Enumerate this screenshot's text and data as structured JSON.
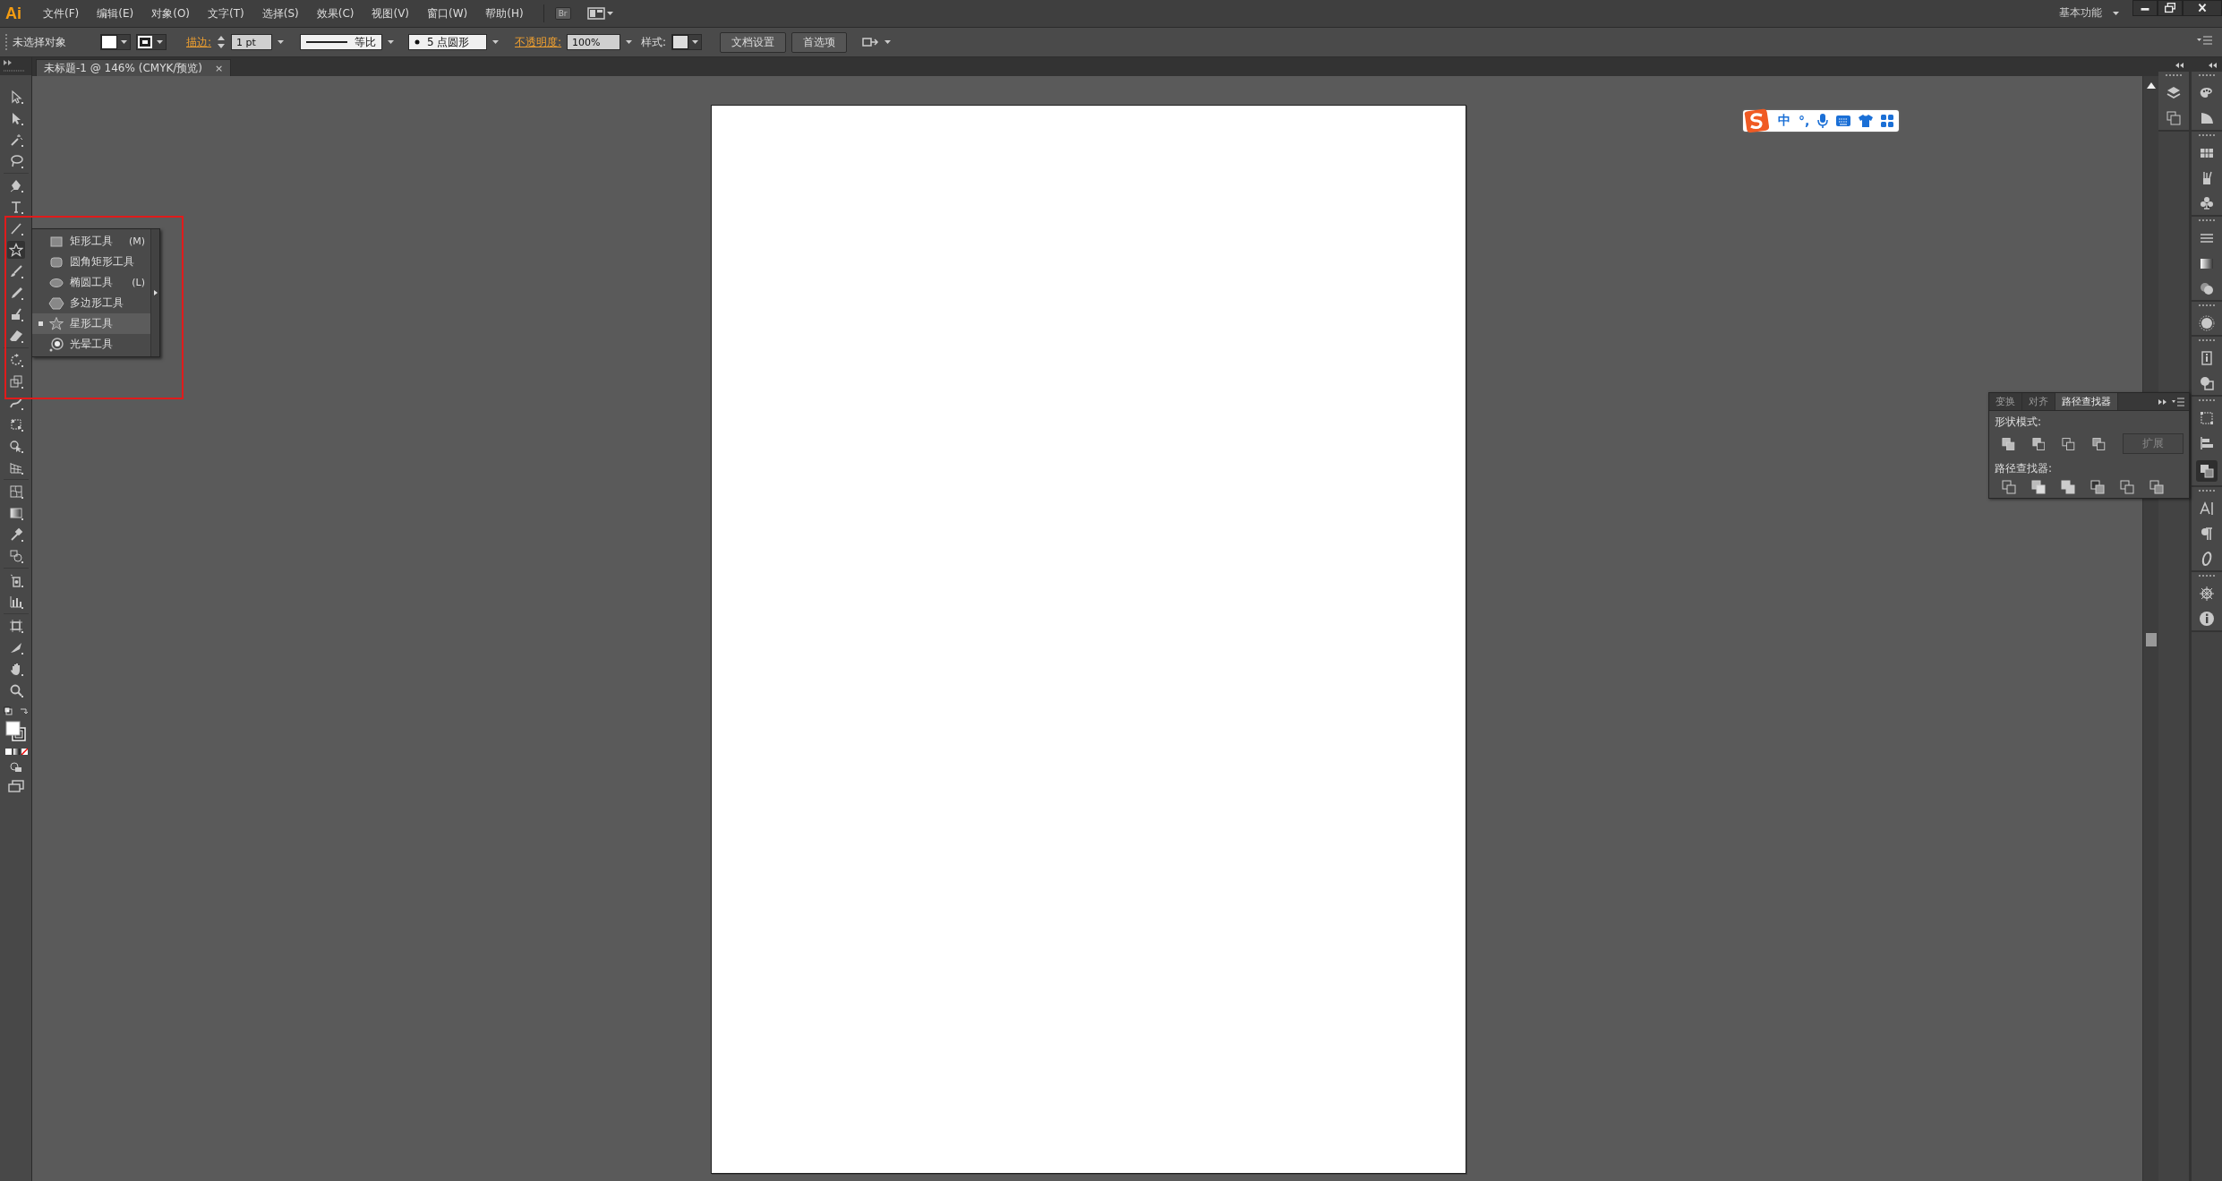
{
  "app": {
    "logo": "Ai"
  },
  "menu": [
    "文件(F)",
    "编辑(E)",
    "对象(O)",
    "文字(T)",
    "选择(S)",
    "效果(C)",
    "视图(V)",
    "窗口(W)",
    "帮助(H)"
  ],
  "bridge_button": "Br",
  "workspace": "基本功能",
  "control_bar": {
    "selection": "未选择对象",
    "stroke_label": "描边:",
    "stroke_weight": "1 pt",
    "profile": "等比",
    "brush": "5 点圆形",
    "opacity_label": "不透明度:",
    "opacity": "100%",
    "style_label": "样式:",
    "buttons": [
      "文档设置",
      "首选项"
    ]
  },
  "document_tab": {
    "title": "未标题-1 @ 146% (CMYK/预览)",
    "close": "×"
  },
  "flyout": [
    {
      "kind": "rect",
      "label": "矩形工具",
      "shortcut": "(M)",
      "selected": false
    },
    {
      "kind": "rounded",
      "label": "圆角矩形工具",
      "selected": false
    },
    {
      "kind": "ellipse",
      "label": "椭圆工具",
      "shortcut": "(L)",
      "selected": false
    },
    {
      "kind": "polygon",
      "label": "多边形工具",
      "selected": false
    },
    {
      "kind": "star",
      "label": "星形工具",
      "selected": true
    },
    {
      "kind": "flare",
      "label": "光晕工具",
      "selected": false
    }
  ],
  "ime_bar": {
    "language": "中",
    "punctuation": "°,"
  },
  "pathfinder": {
    "tabs": [
      {
        "label": "变换",
        "selected": false
      },
      {
        "label": "对齐",
        "selected": false
      },
      {
        "label": "路径查找器",
        "selected": true
      }
    ],
    "shape_modes_label": "形状模式:",
    "expand_button": {
      "label": "扩展",
      "disabled": true
    },
    "pathfinders_label": "路径查找器:"
  }
}
